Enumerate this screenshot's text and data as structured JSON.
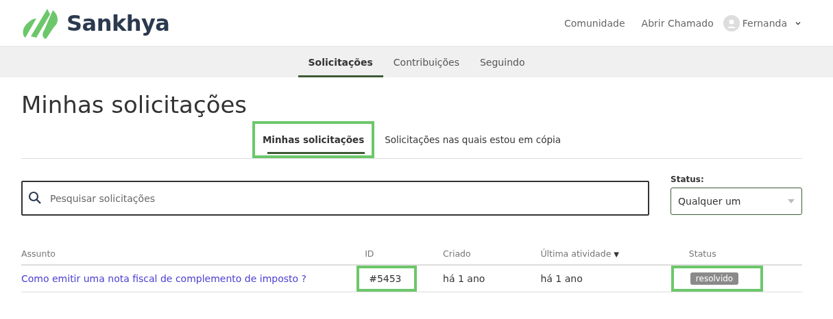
{
  "header": {
    "brand": "Sankhya",
    "links": [
      "Comunidade",
      "Abrir Chamado"
    ],
    "user": {
      "name": "Fernanda"
    }
  },
  "nav": [
    {
      "label": "Solicitações",
      "selected": true
    },
    {
      "label": "Contribuições",
      "selected": false
    },
    {
      "label": "Seguindo",
      "selected": false
    }
  ],
  "page_title": "Minhas solicitações",
  "tabs": [
    {
      "label": "Minhas solicitações",
      "selected": true,
      "highlighted": true
    },
    {
      "label": "Solicitações nas quais estou em cópia",
      "selected": false,
      "highlighted": false
    }
  ],
  "search": {
    "placeholder": "Pesquisar solicitações"
  },
  "status_filter": {
    "label": "Status:",
    "value": "Qualquer um"
  },
  "table": {
    "columns": [
      {
        "label": "Assunto"
      },
      {
        "label": "ID"
      },
      {
        "label": "Criado"
      },
      {
        "label": "Última atividade",
        "sort_indicator": "▼"
      },
      {
        "label": "Status"
      }
    ],
    "rows": [
      {
        "subject": "Como emitir uma nota fiscal de complemento de imposto ?",
        "id": "#5453",
        "id_highlighted": true,
        "created": "há 1 ano",
        "last_activity": "há 1 ano",
        "status": "resolvido",
        "status_highlighted": true
      }
    ]
  }
}
